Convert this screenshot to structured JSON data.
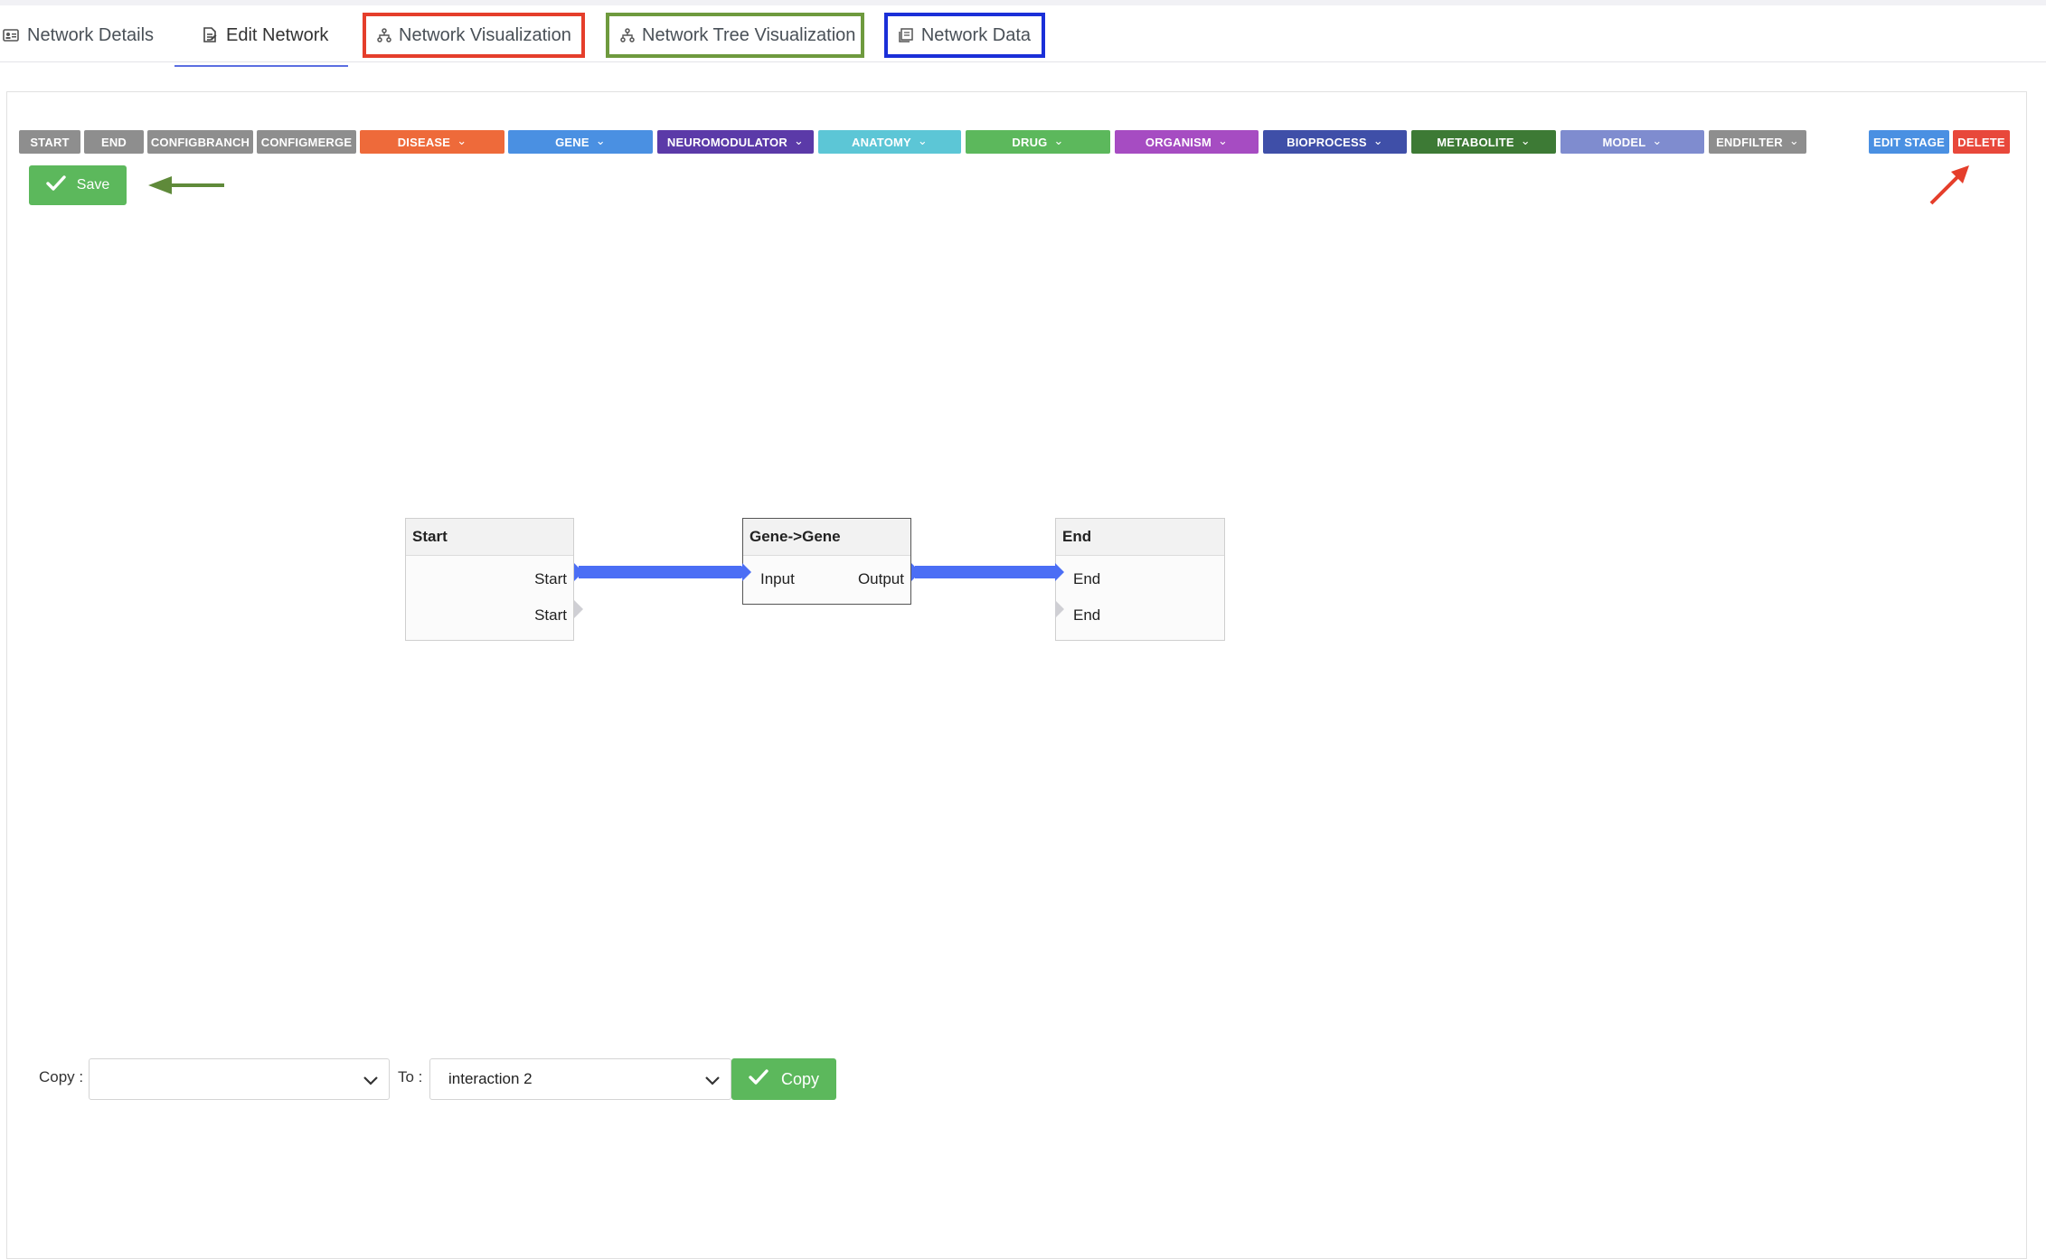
{
  "tabs": [
    {
      "label": "Network Details",
      "icon": "id-card-icon"
    },
    {
      "label": "Edit Network",
      "icon": "edit-document-icon"
    },
    {
      "label": "Network Visualization",
      "icon": "sitemap-icon"
    },
    {
      "label": "Network Tree Visualization",
      "icon": "sitemap-icon"
    },
    {
      "label": "Network Data",
      "icon": "table-icon"
    }
  ],
  "toolbar": {
    "buttons": [
      {
        "label": "START",
        "color": "#8e8e8e",
        "dropdown": false
      },
      {
        "label": "END",
        "color": "#8e8e8e",
        "dropdown": false
      },
      {
        "label": "CONFIGBRANCH",
        "color": "#8e8e8e",
        "dropdown": false
      },
      {
        "label": "CONFIGMERGE",
        "color": "#8e8e8e",
        "dropdown": false
      },
      {
        "label": "DISEASE",
        "color": "#ee6a3a",
        "dropdown": true
      },
      {
        "label": "GENE",
        "color": "#4a90e2",
        "dropdown": true
      },
      {
        "label": "NEUROMODULATOR",
        "color": "#5b3aa8",
        "dropdown": true
      },
      {
        "label": "ANATOMY",
        "color": "#5cc6d6",
        "dropdown": true
      },
      {
        "label": "DRUG",
        "color": "#5cb85c",
        "dropdown": true
      },
      {
        "label": "ORGANISM",
        "color": "#a64cc2",
        "dropdown": true
      },
      {
        "label": "BIOPROCESS",
        "color": "#3f4fa8",
        "dropdown": true
      },
      {
        "label": "METABOLITE",
        "color": "#3d7a35",
        "dropdown": true
      },
      {
        "label": "MODEL",
        "color": "#7f8ccf",
        "dropdown": true
      },
      {
        "label": "ENDFILTER",
        "color": "#8e8e8e",
        "dropdown": true
      }
    ],
    "edit_stage": {
      "label": "EDIT STAGE",
      "color": "#4a90e2"
    },
    "delete": {
      "label": "DELETE",
      "color": "#e8483b"
    },
    "chevron": "⌄"
  },
  "save": {
    "label": "Save",
    "icon": "check-icon"
  },
  "annotations": {
    "green_arrow_color": "#5f8a3a",
    "red_arrow_color": "#e53e2b"
  },
  "nodes": {
    "start": {
      "title": "Start",
      "ports": [
        "Start",
        "Start"
      ]
    },
    "gene": {
      "title": "Gene->Gene",
      "input": "Input",
      "output": "Output"
    },
    "end": {
      "title": "End",
      "ports": [
        "End",
        "End"
      ]
    }
  },
  "connection_color": "#4b6ef5",
  "copy_row": {
    "copy_label": "Copy :",
    "copy_value": "",
    "to_label": "To :",
    "to_value": "interaction 2",
    "button_label": "Copy"
  }
}
